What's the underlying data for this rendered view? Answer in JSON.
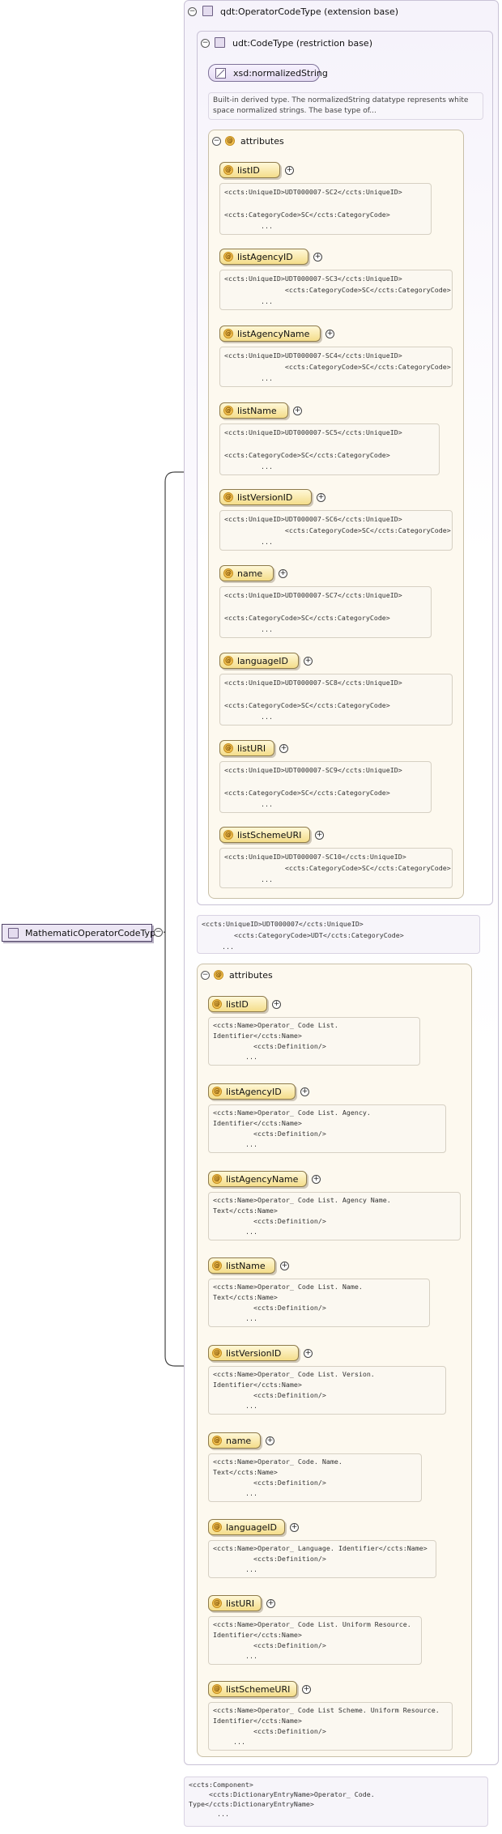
{
  "root": {
    "label": "MathematicOperatorCodeType"
  },
  "extension": {
    "title": "qdt:OperatorCodeType (extension base)"
  },
  "restriction": {
    "title": "udt:CodeType (restriction base)"
  },
  "builtin": {
    "label": "xsd:normalizedString",
    "doc": "Built-in derived type. The normalizedString datatype represents white space normalized strings. The base type of..."
  },
  "inner_attributes": {
    "label": "attributes",
    "items": [
      {
        "name": "listID",
        "doc": "<ccts:UniqueID>UDT000007-SC2</ccts:UniqueID>\n\n<ccts:CategoryCode>SC</ccts:CategoryCode>\n         ..."
      },
      {
        "name": "listAgencyID",
        "doc": "<ccts:UniqueID>UDT000007-SC3</ccts:UniqueID>\n               <ccts:CategoryCode>SC</ccts:CategoryCode>\n         ..."
      },
      {
        "name": "listAgencyName",
        "doc": "<ccts:UniqueID>UDT000007-SC4</ccts:UniqueID>\n               <ccts:CategoryCode>SC</ccts:CategoryCode>\n         ..."
      },
      {
        "name": "listName",
        "doc": "<ccts:UniqueID>UDT000007-SC5</ccts:UniqueID>\n\n<ccts:CategoryCode>SC</ccts:CategoryCode>\n         ..."
      },
      {
        "name": "listVersionID",
        "doc": "<ccts:UniqueID>UDT000007-SC6</ccts:UniqueID>\n               <ccts:CategoryCode>SC</ccts:CategoryCode>\n         ..."
      },
      {
        "name": "name",
        "doc": "<ccts:UniqueID>UDT000007-SC7</ccts:UniqueID>\n\n<ccts:CategoryCode>SC</ccts:CategoryCode>\n         ..."
      },
      {
        "name": "languageID",
        "doc": "<ccts:UniqueID>UDT000007-SC8</ccts:UniqueID>\n\n<ccts:CategoryCode>SC</ccts:CategoryCode>\n         ..."
      },
      {
        "name": "listURI",
        "doc": "<ccts:UniqueID>UDT000007-SC9</ccts:UniqueID>\n\n<ccts:CategoryCode>SC</ccts:CategoryCode>\n         ..."
      },
      {
        "name": "listSchemeURI",
        "doc": "<ccts:UniqueID>UDT000007-SC10</ccts:UniqueID>\n               <ccts:CategoryCode>SC</ccts:CategoryCode>\n         ..."
      }
    ]
  },
  "restriction_doc": "<ccts:UniqueID>UDT000007</ccts:UniqueID>\n        <ccts:CategoryCode>UDT</ccts:CategoryCode>\n     ...",
  "outer_attributes": {
    "label": "attributes",
    "items": [
      {
        "name": "listID",
        "doc": "<ccts:Name>Operator_ Code List.\nIdentifier</ccts:Name>\n          <ccts:Definition/>\n        ..."
      },
      {
        "name": "listAgencyID",
        "doc": "<ccts:Name>Operator_ Code List. Agency.\nIdentifier</ccts:Name>\n          <ccts:Definition/>\n        ..."
      },
      {
        "name": "listAgencyName",
        "doc": "<ccts:Name>Operator_ Code List. Agency Name.\nText</ccts:Name>\n          <ccts:Definition/>\n        ..."
      },
      {
        "name": "listName",
        "doc": "<ccts:Name>Operator_ Code List. Name.\nText</ccts:Name>\n          <ccts:Definition/>\n        ..."
      },
      {
        "name": "listVersionID",
        "doc": "<ccts:Name>Operator_ Code List. Version.\nIdentifier</ccts:Name>\n          <ccts:Definition/>\n        ..."
      },
      {
        "name": "name",
        "doc": "<ccts:Name>Operator_ Code. Name.\nText</ccts:Name>\n          <ccts:Definition/>\n        ..."
      },
      {
        "name": "languageID",
        "doc": "<ccts:Name>Operator_ Language. Identifier</ccts:Name>\n          <ccts:Definition/>\n        ..."
      },
      {
        "name": "listURI",
        "doc": "<ccts:Name>Operator_ Code List. Uniform Resource.\nIdentifier</ccts:Name>\n          <ccts:Definition/>\n        ..."
      },
      {
        "name": "listSchemeURI",
        "doc": "<ccts:Name>Operator_ Code List Scheme. Uniform Resource.\nIdentifier</ccts:Name>\n          <ccts:Definition/>\n     ..."
      }
    ]
  },
  "component_doc": "<ccts:Component>\n     <ccts:DictionaryEntryName>Operator_ Code.\nType</ccts:DictionaryEntryName>\n       ...",
  "icons": {
    "toggle": "⊖",
    "expand": "+",
    "attribute": "@"
  }
}
